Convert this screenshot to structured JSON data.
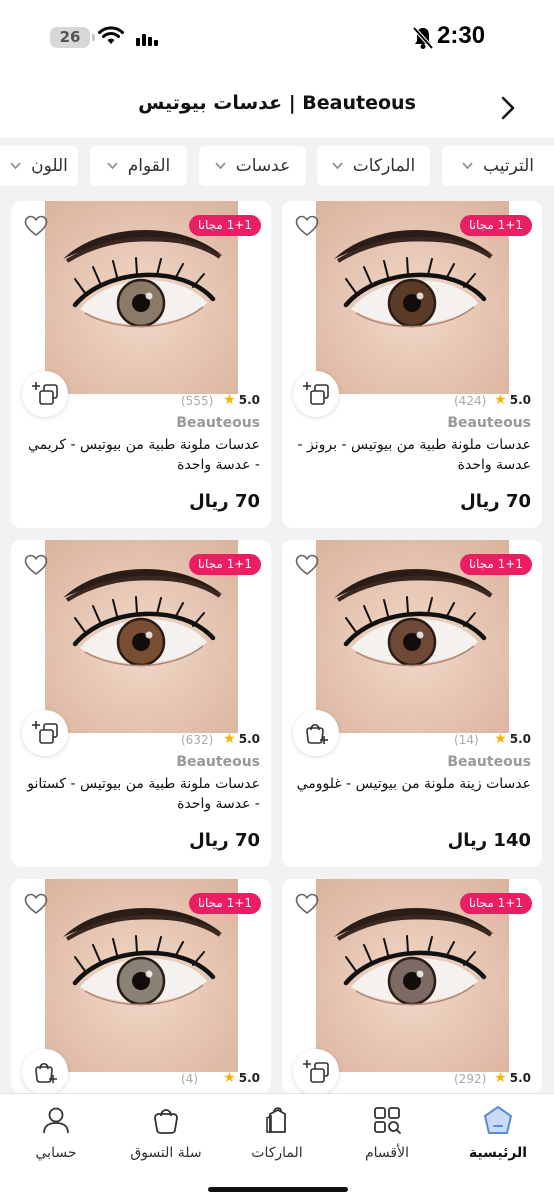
{
  "status_bar": {
    "time": "2:30",
    "battery": "26"
  },
  "header": {
    "title": "عدسات بيوتيس | Beauteous"
  },
  "filters": [
    {
      "label": "الترتيب"
    },
    {
      "label": "الماركات"
    },
    {
      "label": "عدسات"
    },
    {
      "label": "القوام"
    },
    {
      "label": "اللون"
    }
  ],
  "products": [
    {
      "promo": "1+1 مجانا",
      "rating": "5.0",
      "reviews": "(424)",
      "brand": "Beauteous",
      "name": "عدسات ملونة طبية من بيوتيس - برونز - عدسة واحدة",
      "price": "70 ريال",
      "add_icon": "multi-add-icon",
      "iris_color": "#5a3c26"
    },
    {
      "promo": "1+1 مجانا",
      "rating": "5.0",
      "reviews": "(555)",
      "brand": "Beauteous",
      "name": "عدسات ملونة طبية من بيوتيس - كريمي - عدسة واحدة",
      "price": "70 ريال",
      "add_icon": "multi-add-icon",
      "iris_color": "#8c7a68"
    },
    {
      "promo": "1+1 مجانا",
      "rating": "5.0",
      "reviews": "(14)",
      "brand": "Beauteous",
      "name": "عدسات زينة ملونة من بيوتيس - غلوومي",
      "price": "140 ريال",
      "add_icon": "bag-add-icon",
      "iris_color": "#6e4a36"
    },
    {
      "promo": "1+1 مجانا",
      "rating": "5.0",
      "reviews": "(632)",
      "brand": "Beauteous",
      "name": "عدسات ملونة طبية من بيوتيس - كستانو - عدسة واحدة",
      "price": "70 ريال",
      "add_icon": "multi-add-icon",
      "iris_color": "#7a4e32"
    },
    {
      "promo": "1+1 مجانا",
      "rating": "5.0",
      "reviews": "(292)",
      "brand": "",
      "name": "",
      "price": "",
      "add_icon": "multi-add-icon",
      "iris_color": "#7d6a64"
    },
    {
      "promo": "1+1 مجانا",
      "rating": "5.0",
      "reviews": "(4)",
      "brand": "",
      "name": "",
      "price": "",
      "add_icon": "bag-add-icon",
      "iris_color": "#8a8276"
    }
  ],
  "bottom_nav": [
    {
      "label": "الرئيسية",
      "icon": "home-icon",
      "active": true
    },
    {
      "label": "الأقسام",
      "icon": "categories-icon",
      "active": false
    },
    {
      "label": "الماركات",
      "icon": "brands-icon",
      "active": false
    },
    {
      "label": "سلة التسوق",
      "icon": "cart-icon",
      "active": false
    },
    {
      "label": "حسابي",
      "icon": "account-icon",
      "active": false
    }
  ],
  "colors": {
    "accent": "#e91e63",
    "star": "#f5b400",
    "active_tab": "#5b8ad6"
  }
}
